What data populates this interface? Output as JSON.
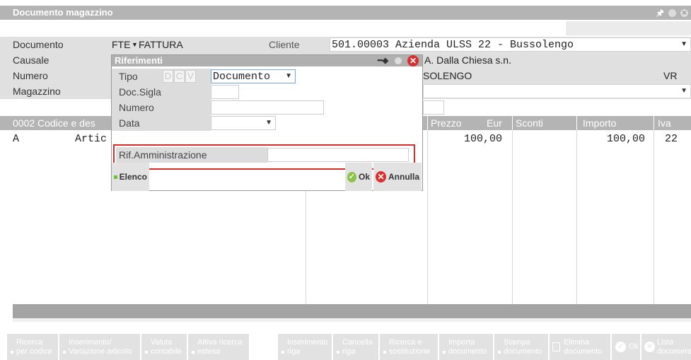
{
  "window": {
    "title": "Documento magazzino"
  },
  "form": {
    "documento_label": "Documento",
    "documento_value": "FTE",
    "documento_desc": "FATTURA",
    "cliente_label": "Cliente",
    "cliente_value": "501.00003 Azienda ULSS 22 - Bussolengo",
    "causale_label": "Causale",
    "address": "A. Dalla Chiesa s.n.",
    "numero_label": "Numero",
    "city": "SOLENGO",
    "province": "VR",
    "magazzino_label": "Magazzino"
  },
  "grid": {
    "headers": {
      "code": "0002  Codice e des",
      "prezzo": "Prezzo",
      "valuta": "Eur",
      "sconti": "Sconti",
      "importo": "Importo",
      "iva": "Iva"
    },
    "rows": [
      {
        "tipo": "A",
        "desc": "Artic",
        "prezzo": "100,00",
        "importo": "100,00",
        "iva": "22"
      }
    ]
  },
  "dialog": {
    "title": "Riferimenti",
    "tipo_label": "Tipo",
    "tipo_codes": [
      "D",
      "C",
      "V"
    ],
    "tipo_value": "Documento",
    "docsigla_label": "Doc.Sigla",
    "numero_label": "Numero",
    "data_label": "Data",
    "rif_label": "Rif.Amministrazione",
    "elenco_label": "Elenco",
    "ok_label": "Ok",
    "annulla_label": "Annulla"
  },
  "toolbar": {
    "buttons": [
      {
        "line1": "Ricerca",
        "line2": "per codice"
      },
      {
        "line1": "Inserimento/",
        "line2": "Variazione articolo"
      },
      {
        "line1": "Valuta",
        "line2": "contabile"
      },
      {
        "line1": "Attiva ricerca",
        "line2": "estesa"
      },
      {
        "line1": "Inserimento",
        "line2": "riga"
      },
      {
        "line1": "Cancella",
        "line2": "riga"
      },
      {
        "line1": "Ricerca e",
        "line2": "sostituzione"
      },
      {
        "line1": "Importa",
        "line2": "documento"
      },
      {
        "line1": "Stampa",
        "line2": "documento"
      },
      {
        "line1": "Elimina",
        "line2": "documento"
      },
      {
        "line1": "Ok",
        "line2": ""
      },
      {
        "line1": "Lista",
        "line2": "documenti"
      }
    ]
  },
  "colors": {
    "accent_red": "#d82b2b",
    "ok_green": "#8bc34a",
    "header_grey": "#b4b4b4"
  }
}
